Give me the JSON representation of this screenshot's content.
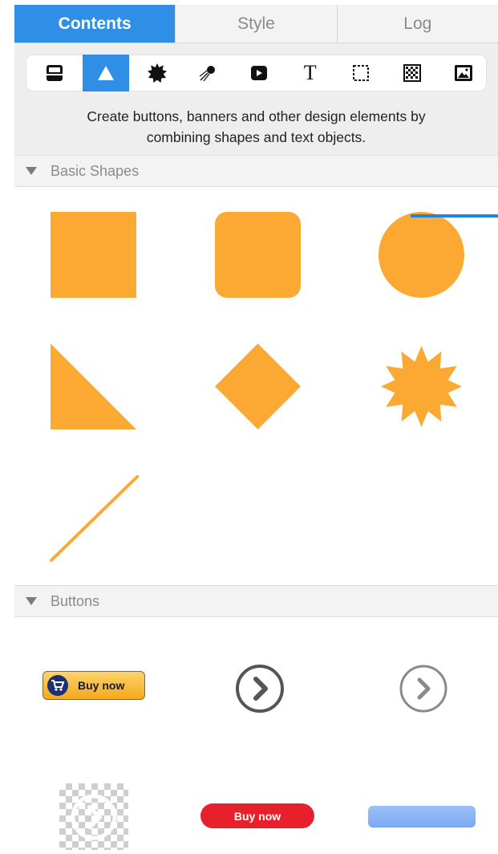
{
  "tabs": [
    {
      "label": "Contents",
      "active": true
    },
    {
      "label": "Style",
      "active": false
    },
    {
      "label": "Log",
      "active": false
    }
  ],
  "toolbar": {
    "tools": [
      {
        "icon": "layout-icon",
        "active": false
      },
      {
        "icon": "triangle-shape-icon",
        "active": true
      },
      {
        "icon": "starburst-icon",
        "active": false
      },
      {
        "icon": "comet-icon",
        "active": false
      },
      {
        "icon": "video-icon",
        "active": false
      },
      {
        "icon": "text-icon",
        "glyph": "T",
        "active": false
      },
      {
        "icon": "dashed-rectangle-icon",
        "active": false
      },
      {
        "icon": "pattern-icon",
        "active": false
      },
      {
        "icon": "image-icon",
        "active": false
      }
    ],
    "accent_color": "#2f8fe6"
  },
  "description": {
    "line1": "Create buttons, banners and other design elements by",
    "line2": "combining shapes and text objects."
  },
  "sections": {
    "basic_shapes": {
      "title": "Basic Shapes",
      "expanded": true,
      "items": [
        "square",
        "rounded-square",
        "circle",
        "right-triangle",
        "diamond",
        "starburst",
        "line"
      ],
      "shape_color": "#fba933"
    },
    "buttons": {
      "title": "Buttons",
      "expanded": true,
      "items": [
        {
          "type": "buy-now-yellow",
          "label": "Buy now"
        },
        {
          "type": "circle-arrow-dark"
        },
        {
          "type": "circle-arrow-light"
        },
        {
          "type": "circle-arrow-transparent"
        },
        {
          "type": "buy-now-red",
          "label": "Buy now"
        },
        {
          "type": "blue-bar"
        }
      ]
    }
  }
}
